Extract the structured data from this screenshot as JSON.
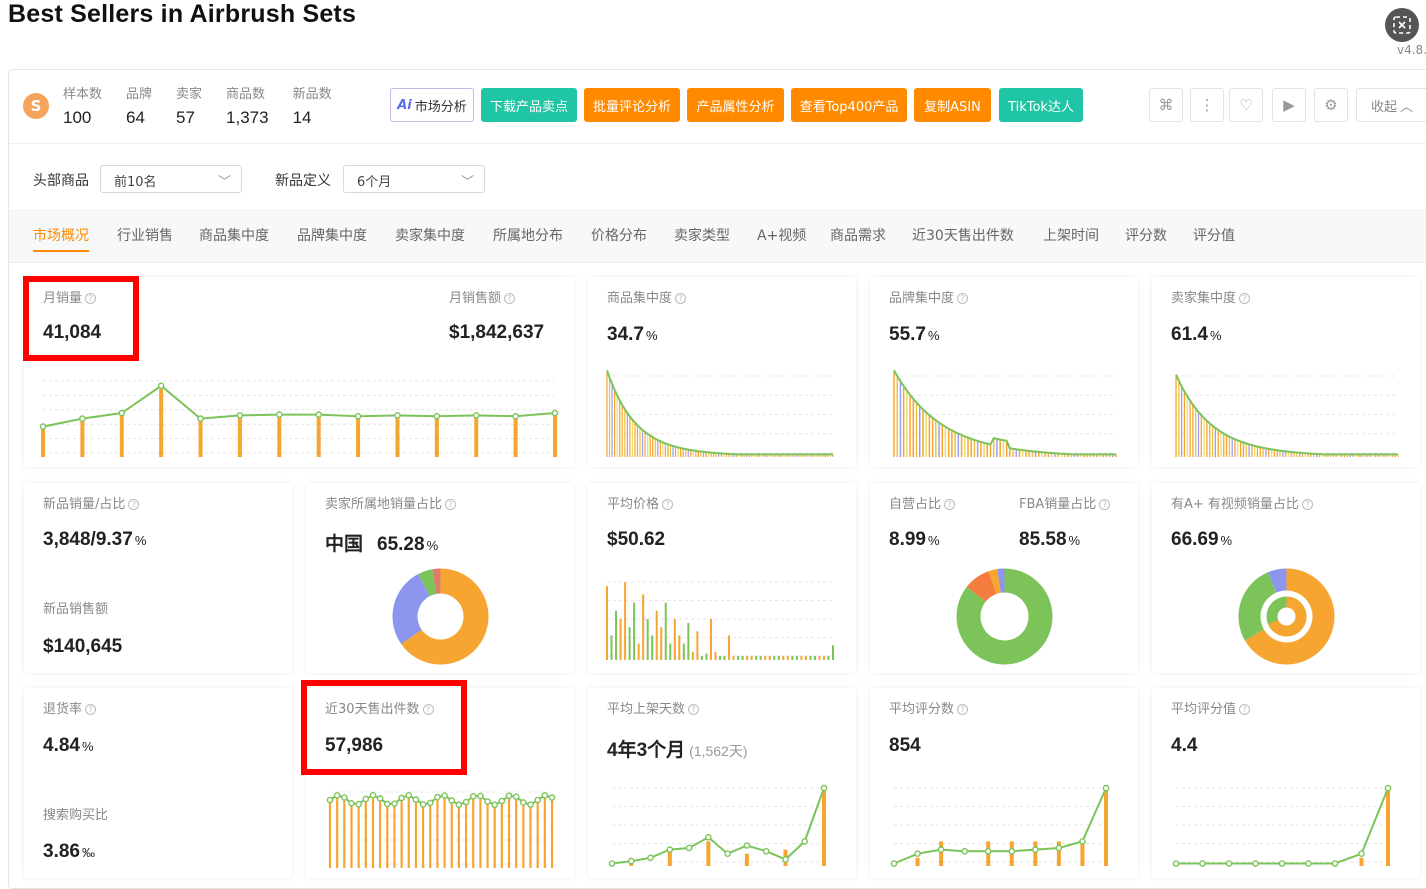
{
  "header": {
    "title": "Best Sellers in Airbrush Sets",
    "version": "v4.8."
  },
  "stats": [
    {
      "label": "样本数",
      "value": "100"
    },
    {
      "label": "品牌",
      "value": "64"
    },
    {
      "label": "卖家",
      "value": "57"
    },
    {
      "label": "商品数",
      "value": "1,373"
    },
    {
      "label": "新品数",
      "value": "14"
    }
  ],
  "toolbar": {
    "ai_mark": "Ai",
    "market_analysis": "市场分析",
    "download_points": "下载产品卖点",
    "batch_review": "批量评论分析",
    "attr_analysis": "产品属性分析",
    "top400": "查看Top400产品",
    "copy_asin": "复制ASIN",
    "tiktok": "TikTok达人",
    "collapse": "收起"
  },
  "filters": {
    "head_label": "头部商品",
    "head_value": "前10名",
    "new_label": "新品定义",
    "new_value": "6个月"
  },
  "tabs": [
    "市场概况",
    "行业销售",
    "商品集中度",
    "品牌集中度",
    "卖家集中度",
    "所属地分布",
    "价格分布",
    "卖家类型",
    "A+视频",
    "商品需求",
    "近30天售出件数",
    "上架时间",
    "评分数",
    "评分值"
  ],
  "cards": {
    "monthly_sales": {
      "label": "月销量",
      "value": "41,084"
    },
    "monthly_revenue": {
      "label": "月销售额",
      "value": "$1,842,637"
    },
    "product_conc": {
      "label": "商品集中度",
      "value": "34.7",
      "unit": "%"
    },
    "brand_conc": {
      "label": "品牌集中度",
      "value": "55.7",
      "unit": "%"
    },
    "seller_conc": {
      "label": "卖家集中度",
      "value": "61.4",
      "unit": "%"
    },
    "new_sales": {
      "label": "新品销量/占比",
      "value": "3,848/9.37",
      "unit": "%",
      "label2": "新品销售额",
      "value2": "$140,645"
    },
    "seller_region": {
      "label": "卖家所属地销量占比",
      "region": "中国",
      "value": "65.28",
      "unit": "%"
    },
    "avg_price": {
      "label": "平均价格",
      "value": "$50.62"
    },
    "self_fba": {
      "label": "自营占比",
      "value": "8.99",
      "unit": "%",
      "label2": "FBA销量占比",
      "value2": "85.58",
      "unit2": "%"
    },
    "aplus": {
      "label": "有A+ 有视频销量占比",
      "value": "66.69",
      "unit": "%"
    },
    "return_rate": {
      "label": "退货率",
      "value": "4.84",
      "unit": "%",
      "label2": "搜索购买比",
      "value2": "3.86",
      "unit2": "‰"
    },
    "sold_30d": {
      "label": "近30天售出件数",
      "value": "57,986"
    },
    "avg_days": {
      "label": "平均上架天数",
      "value": "4年3个月",
      "sub": "(1,562天)"
    },
    "avg_reviews": {
      "label": "平均评分数",
      "value": "854"
    },
    "avg_rating": {
      "label": "平均评分值",
      "value": "4.4"
    }
  },
  "colors": {
    "orange": "#f7a531",
    "green": "#7cc35a",
    "accent": "#ff8a00",
    "teal": "#1fc5a4",
    "highlight": "#ff0000",
    "purple": "#8e95ef"
  }
}
